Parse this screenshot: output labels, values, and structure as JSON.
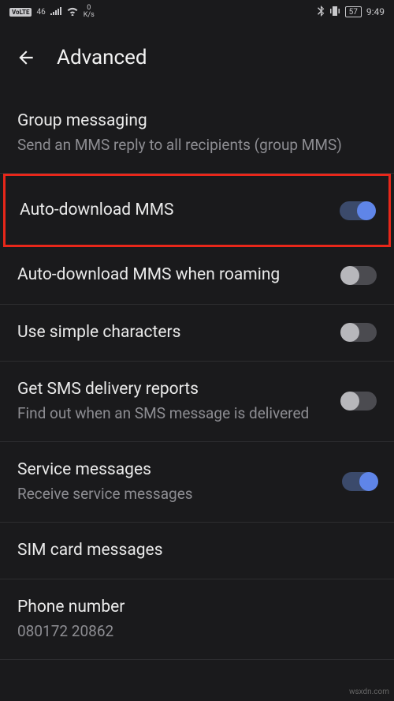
{
  "status": {
    "volte": "VoLTE",
    "network": "46",
    "speed_val": "0",
    "speed_unit": "K/s",
    "battery": "57",
    "time": "9:49"
  },
  "header": {
    "title": "Advanced"
  },
  "settings": {
    "group_messaging": {
      "title": "Group messaging",
      "sub": "Send an MMS reply to all recipients (group MMS)"
    },
    "auto_download": {
      "title": "Auto-download MMS",
      "enabled": true
    },
    "auto_download_roaming": {
      "title": "Auto-download MMS when roaming",
      "enabled": false
    },
    "simple_chars": {
      "title": "Use simple characters",
      "enabled": false
    },
    "delivery_reports": {
      "title": "Get SMS delivery reports",
      "sub": "Find out when an SMS message is delivered",
      "enabled": false
    },
    "service_messages": {
      "title": "Service messages",
      "sub": "Receive service messages",
      "enabled": true
    },
    "sim_card": {
      "title": "SIM card messages"
    },
    "phone_number": {
      "title": "Phone number",
      "value": "080172 20862"
    }
  },
  "watermark": "wsxdn.com"
}
